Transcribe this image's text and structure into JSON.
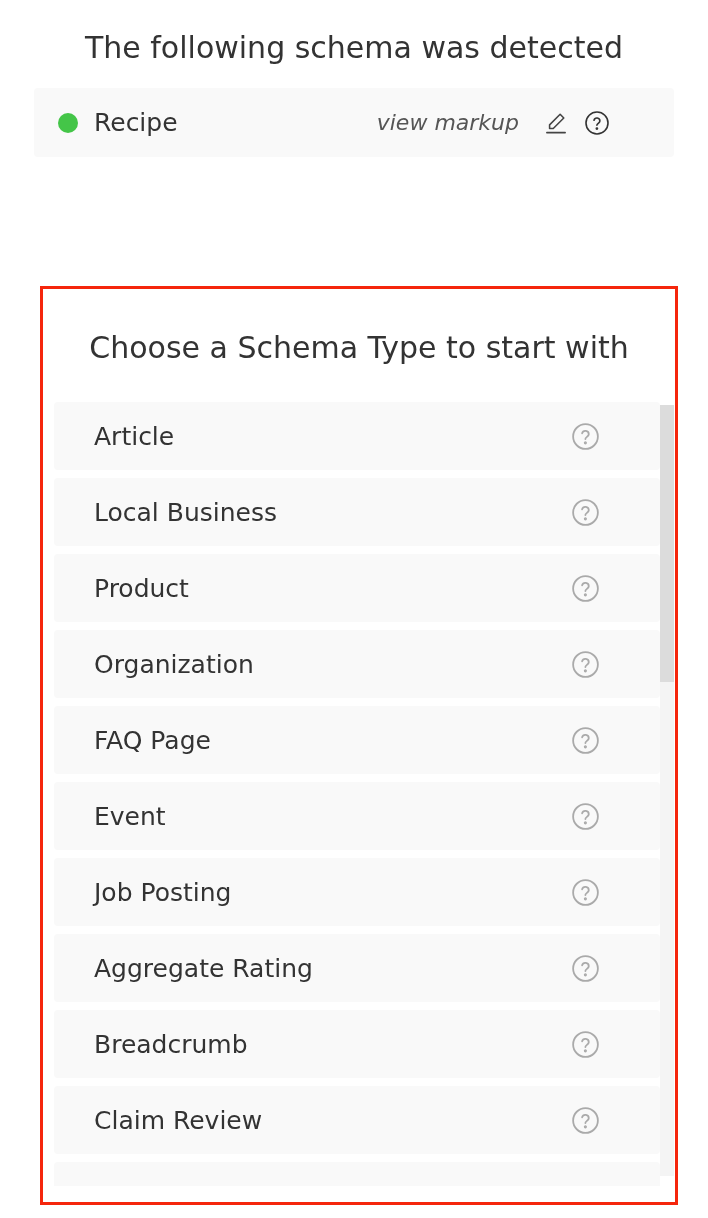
{
  "title": "The following schema was detected",
  "detected_schemas": [
    {
      "name": "Recipe",
      "color": "#44c548",
      "link": "view markup"
    }
  ],
  "chooser": {
    "highlighted": true,
    "heading": "Choose a Schema Type to start with",
    "schema_types": [
      {
        "label": "Article"
      },
      {
        "label": "Local Business"
      },
      {
        "label": "Product"
      },
      {
        "label": "Organization"
      },
      {
        "label": "FAQ Page"
      },
      {
        "label": "Event"
      },
      {
        "label": "Job Posting"
      },
      {
        "label": "Aggregate Rating"
      },
      {
        "label": "Breadcrumb"
      },
      {
        "label": "Claim Review"
      }
    ]
  }
}
